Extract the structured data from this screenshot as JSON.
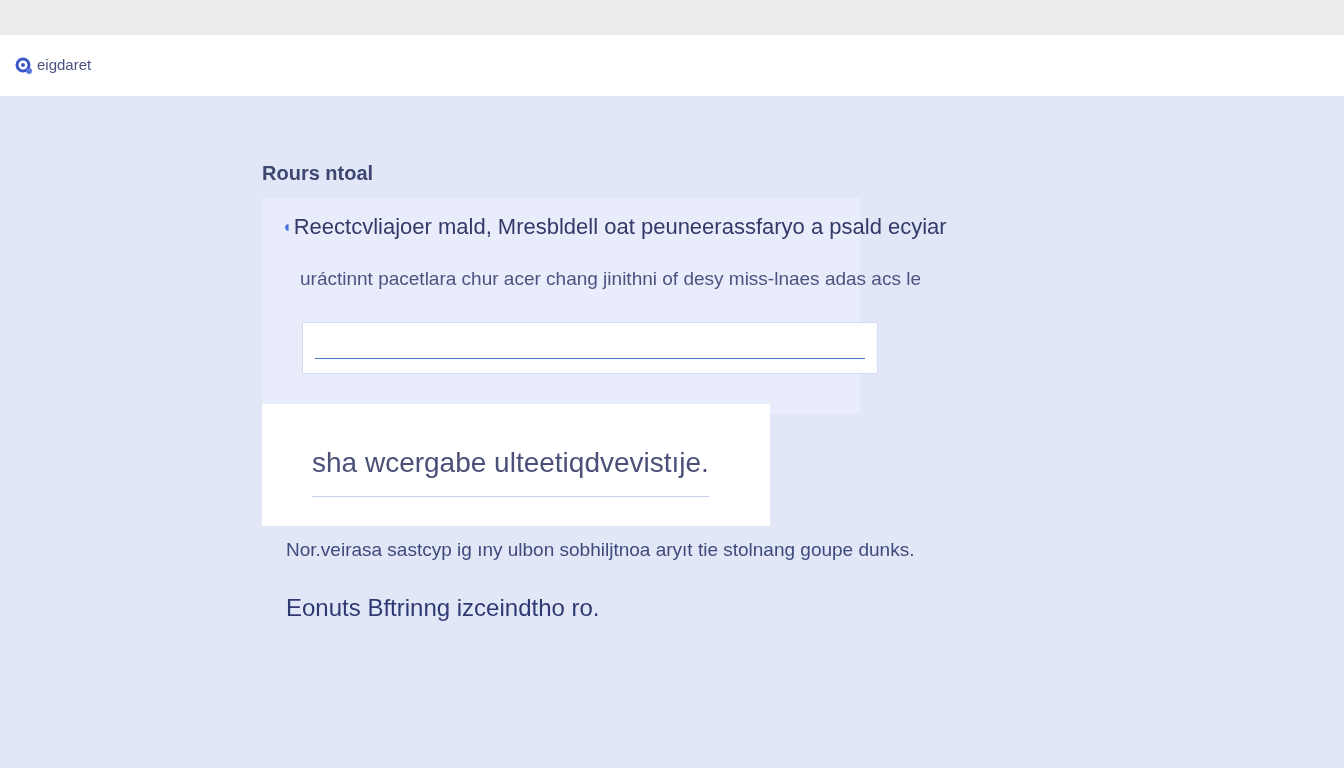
{
  "header": {
    "brand": "eigdaret"
  },
  "section": {
    "title": "Rours ntoal",
    "question": {
      "bullet": "◖",
      "text": "Reectcvliajoer mald, Mresbldell oat peuneerassfaryo a psald ecyiar"
    },
    "hint": "uráctinnt pacetlara chur acer chang jinithni of desy miss-lnaes adas acs le",
    "response_box": {
      "value": "sha wcergabe ulteetiqdvevistıje."
    },
    "note": "Nor.veirasa sastcyp ig ıny ulbon sobhiljtnoa aryıt tie stolnang goupe dunks.",
    "footer_text": "Eonuts Bftrinng izceindtho ro."
  }
}
